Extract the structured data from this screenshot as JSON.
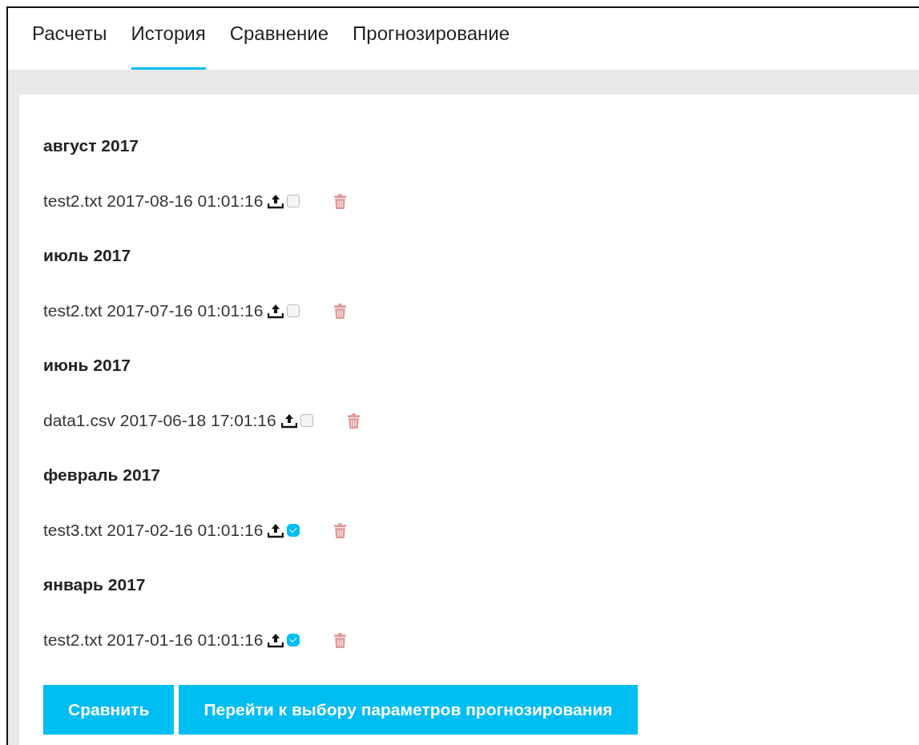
{
  "tabs": [
    {
      "label": "Расчеты",
      "selected": false
    },
    {
      "label": "История",
      "selected": true
    },
    {
      "label": "Сравнение",
      "selected": false
    },
    {
      "label": "Прогнозирование",
      "selected": false
    }
  ],
  "groups": [
    {
      "heading": "август 2017",
      "files": [
        {
          "name": "test2.txt 2017-08-16 01:01:16",
          "checked": false
        }
      ]
    },
    {
      "heading": "июль 2017",
      "files": [
        {
          "name": "test2.txt 2017-07-16 01:01:16",
          "checked": false
        }
      ]
    },
    {
      "heading": "июнь 2017",
      "files": [
        {
          "name": "data1.csv 2017-06-18 17:01:16",
          "checked": false
        }
      ]
    },
    {
      "heading": "февраль 2017",
      "files": [
        {
          "name": "test3.txt 2017-02-16 01:01:16",
          "checked": true
        }
      ]
    },
    {
      "heading": "январь 2017",
      "files": [
        {
          "name": "test2.txt 2017-01-16 01:01:16",
          "checked": true
        }
      ]
    }
  ],
  "buttons": [
    "Сравнить",
    "Перейти к выбору параметров прогнозирования"
  ]
}
